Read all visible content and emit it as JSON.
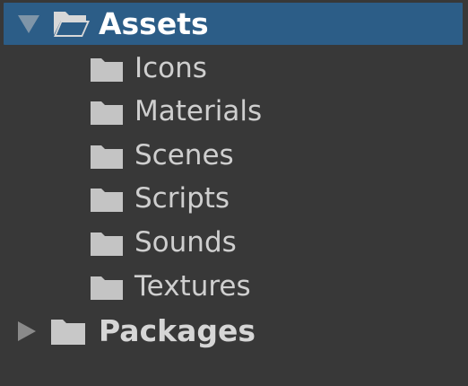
{
  "tree": {
    "assets": {
      "label": "Assets",
      "expanded": true,
      "selected": true,
      "children": [
        {
          "label": "Icons"
        },
        {
          "label": "Materials"
        },
        {
          "label": "Scenes"
        },
        {
          "label": "Scripts"
        },
        {
          "label": "Sounds"
        },
        {
          "label": "Textures"
        }
      ]
    },
    "packages": {
      "label": "Packages",
      "expanded": false
    }
  },
  "colors": {
    "background": "#383838",
    "selection": "#2c5d87",
    "folder": "#c4c4c4",
    "text": "#cfcfcf"
  }
}
